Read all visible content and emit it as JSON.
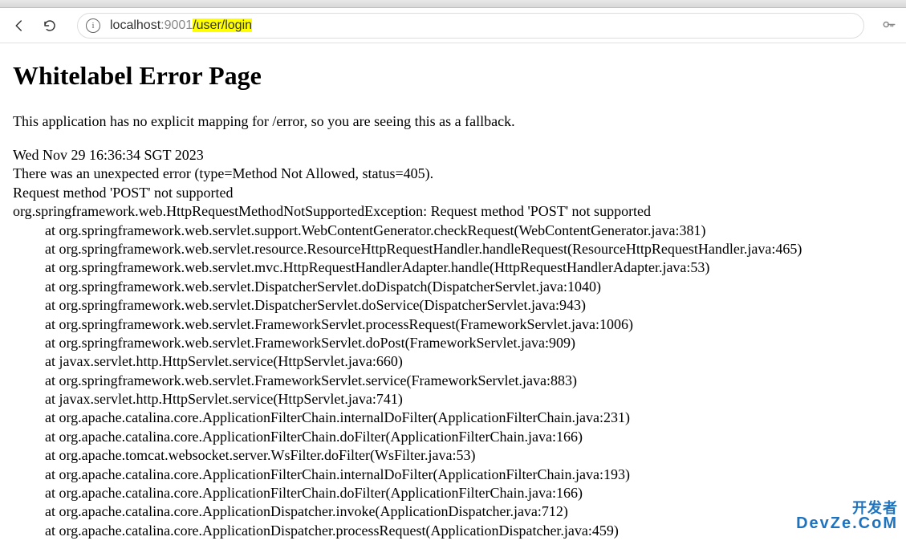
{
  "url": {
    "host": "localhost",
    "port": ":9001",
    "path": "/user/login"
  },
  "page": {
    "title": "Whitelabel Error Page",
    "fallback": "This application has no explicit mapping for /error, so you are seeing this as a fallback.",
    "timestamp": "Wed Nov 29 16:36:34 SGT 2023",
    "summary": "There was an unexpected error (type=Method Not Allowed, status=405).",
    "message": "Request method 'POST' not supported",
    "exception": "org.springframework.web.HttpRequestMethodNotSupportedException: Request method 'POST' not supported",
    "trace": [
      "at org.springframework.web.servlet.support.WebContentGenerator.checkRequest(WebContentGenerator.java:381)",
      "at org.springframework.web.servlet.resource.ResourceHttpRequestHandler.handleRequest(ResourceHttpRequestHandler.java:465)",
      "at org.springframework.web.servlet.mvc.HttpRequestHandlerAdapter.handle(HttpRequestHandlerAdapter.java:53)",
      "at org.springframework.web.servlet.DispatcherServlet.doDispatch(DispatcherServlet.java:1040)",
      "at org.springframework.web.servlet.DispatcherServlet.doService(DispatcherServlet.java:943)",
      "at org.springframework.web.servlet.FrameworkServlet.processRequest(FrameworkServlet.java:1006)",
      "at org.springframework.web.servlet.FrameworkServlet.doPost(FrameworkServlet.java:909)",
      "at javax.servlet.http.HttpServlet.service(HttpServlet.java:660)",
      "at org.springframework.web.servlet.FrameworkServlet.service(FrameworkServlet.java:883)",
      "at javax.servlet.http.HttpServlet.service(HttpServlet.java:741)",
      "at org.apache.catalina.core.ApplicationFilterChain.internalDoFilter(ApplicationFilterChain.java:231)",
      "at org.apache.catalina.core.ApplicationFilterChain.doFilter(ApplicationFilterChain.java:166)",
      "at org.apache.tomcat.websocket.server.WsFilter.doFilter(WsFilter.java:53)",
      "at org.apache.catalina.core.ApplicationFilterChain.internalDoFilter(ApplicationFilterChain.java:193)",
      "at org.apache.catalina.core.ApplicationFilterChain.doFilter(ApplicationFilterChain.java:166)",
      "at org.apache.catalina.core.ApplicationDispatcher.invoke(ApplicationDispatcher.java:712)",
      "at org.apache.catalina.core.ApplicationDispatcher.processRequest(ApplicationDispatcher.java:459)"
    ]
  },
  "watermark": {
    "l1": "开发者",
    "l2": "DevZe.CoM"
  }
}
